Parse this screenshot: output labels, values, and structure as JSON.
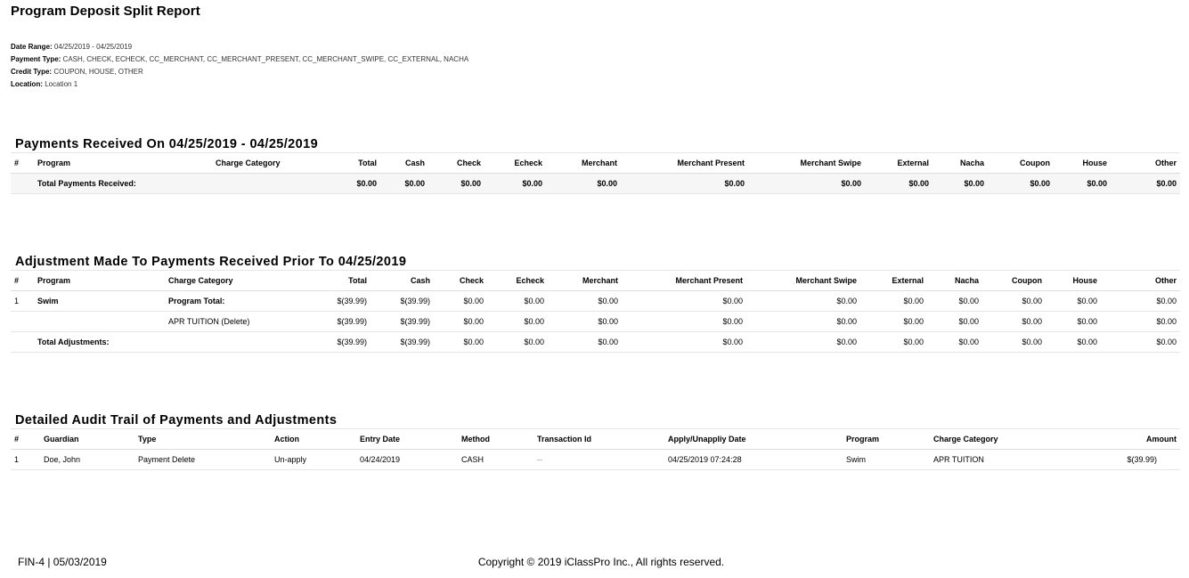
{
  "title": "Program Deposit Split Report",
  "filters": [
    {
      "label": "Date Range:",
      "value": "04/25/2019 - 04/25/2019"
    },
    {
      "label": "Payment Type:",
      "value": "CASH, CHECK, ECHECK, CC_MERCHANT, CC_MERCHANT_PRESENT, CC_MERCHANT_SWIPE, CC_EXTERNAL, NACHA"
    },
    {
      "label": "Credit Type:",
      "value": "COUPON, HOUSE, OTHER"
    },
    {
      "label": "Location:",
      "value": "Location 1"
    }
  ],
  "payments": {
    "heading": "Payments Received On 04/25/2019 - 04/25/2019",
    "columns": [
      "#",
      "Program",
      "Charge Category",
      "Total",
      "Cash",
      "Check",
      "Echeck",
      "Merchant",
      "Merchant Present",
      "Merchant Swipe",
      "External",
      "Nacha",
      "Coupon",
      "House",
      "Other"
    ],
    "total_row": {
      "label": "Total Payments Received:",
      "values": [
        "$0.00",
        "$0.00",
        "$0.00",
        "$0.00",
        "$0.00",
        "$0.00",
        "$0.00",
        "$0.00",
        "$0.00",
        "$0.00",
        "$0.00",
        "$0.00"
      ]
    }
  },
  "adjustments": {
    "heading": "Adjustment Made To Payments Received Prior To 04/25/2019",
    "columns": [
      "#",
      "Program",
      "Charge Category",
      "Total",
      "Cash",
      "Check",
      "Echeck",
      "Merchant",
      "Merchant Present",
      "Merchant Swipe",
      "External",
      "Nacha",
      "Coupon",
      "House",
      "Other"
    ],
    "rows": [
      {
        "num": "1",
        "program": "Swim",
        "category": "Program Total:",
        "values": [
          "$(39.99)",
          "$(39.99)",
          "$0.00",
          "$0.00",
          "$0.00",
          "$0.00",
          "$0.00",
          "$0.00",
          "$0.00",
          "$0.00",
          "$0.00",
          "$0.00"
        ]
      },
      {
        "num": "",
        "program": "",
        "category": "APR TUITION (Delete)",
        "values": [
          "$(39.99)",
          "$(39.99)",
          "$0.00",
          "$0.00",
          "$0.00",
          "$0.00",
          "$0.00",
          "$0.00",
          "$0.00",
          "$0.00",
          "$0.00",
          "$0.00"
        ]
      }
    ],
    "total_row": {
      "label": "Total Adjustments:",
      "values": [
        "$(39.99)",
        "$(39.99)",
        "$0.00",
        "$0.00",
        "$0.00",
        "$0.00",
        "$0.00",
        "$0.00",
        "$0.00",
        "$0.00",
        "$0.00",
        "$0.00"
      ]
    }
  },
  "audit": {
    "heading": "Detailed Audit Trail of Payments and Adjustments",
    "columns": [
      "#",
      "Guardian",
      "Type",
      "Action",
      "Entry Date",
      "Method",
      "Transaction Id",
      "Apply/Unappliy Date",
      "Program",
      "Charge Category",
      "Amount"
    ],
    "rows": [
      {
        "num": "1",
        "guardian": "Doe, John",
        "type": "Payment Delete",
        "action": "Un-apply",
        "entry_date": "04/24/2019",
        "method": "CASH",
        "transaction_id": "--",
        "apply_date": "04/25/2019 07:24:28",
        "program": "Swim",
        "category": "APR TUITION",
        "amount": "$(39.99)"
      }
    ]
  },
  "footer": {
    "left": "FIN-4 | 05/03/2019",
    "center": "Copyright © 2019 iClassPro Inc., All rights reserved."
  }
}
